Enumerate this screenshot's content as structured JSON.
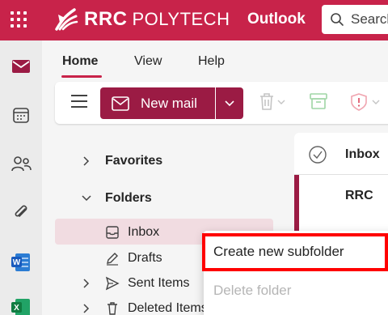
{
  "header": {
    "brand_bold": "RRC",
    "brand_light": "POLYTECH",
    "app_name": "Outlook",
    "search_placeholder": "Search",
    "bar_color": "#c8234a"
  },
  "rail": {
    "icons": [
      "mail-icon",
      "calendar-icon",
      "people-icon",
      "attachment-icon",
      "word-icon",
      "excel-icon"
    ]
  },
  "nav": {
    "tabs": [
      {
        "label": "Home",
        "active": true
      },
      {
        "label": "View",
        "active": false
      },
      {
        "label": "Help",
        "active": false
      }
    ]
  },
  "ribbon": {
    "new_mail_label": "New mail",
    "accent": "#9b1b44"
  },
  "folders": {
    "favorites_label": "Favorites",
    "folders_label": "Folders",
    "items": [
      {
        "label": "Inbox",
        "icon": "inbox-icon",
        "selected": true
      },
      {
        "label": "Drafts",
        "icon": "drafts-icon"
      },
      {
        "label": "Sent Items",
        "icon": "sent-icon"
      },
      {
        "label": "Deleted Items",
        "icon": "trash-icon"
      }
    ]
  },
  "message_list": {
    "header_label": "Inbox",
    "first_sender": "RRC"
  },
  "context_menu": {
    "items": [
      {
        "label": "Create new subfolder",
        "enabled": true,
        "highlighted": true
      },
      {
        "label": "Delete folder",
        "enabled": false
      }
    ],
    "highlight_color": "#ff0000"
  }
}
